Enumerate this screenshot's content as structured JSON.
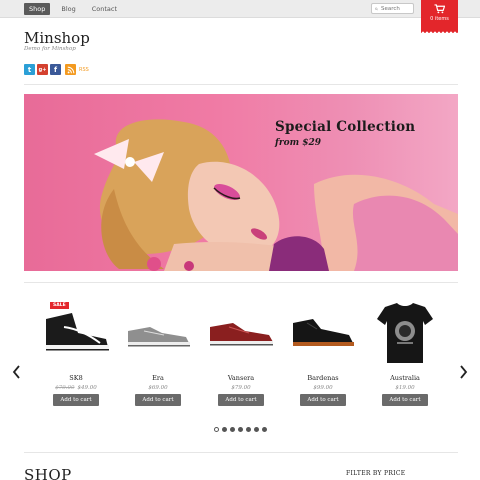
{
  "nav": {
    "items": [
      {
        "label": "Shop",
        "active": true
      },
      {
        "label": "Blog",
        "active": false
      },
      {
        "label": "Contact",
        "active": false
      }
    ]
  },
  "search": {
    "placeholder": "Search"
  },
  "cart": {
    "label": "0 items",
    "icon": "cart-icon",
    "color": "#e3262b"
  },
  "site": {
    "title": "Minshop",
    "tagline": "Demo for Minshop"
  },
  "social": {
    "icons": [
      "twitter-icon",
      "google-plus-icon",
      "facebook-icon",
      "rss-icon"
    ],
    "rss_label": "RSS"
  },
  "banner": {
    "title": "Special Collection",
    "subtitle": "from $29"
  },
  "products": [
    {
      "name": "SK8",
      "old_price": "$79.00",
      "price": "$49.00",
      "button": "Add to cart",
      "badge": "SALE"
    },
    {
      "name": "Era",
      "old_price": "",
      "price": "$69.00",
      "button": "Add to cart",
      "badge": ""
    },
    {
      "name": "Vansera",
      "old_price": "",
      "price": "$79.00",
      "button": "Add to cart",
      "badge": ""
    },
    {
      "name": "Bardenas",
      "old_price": "",
      "price": "$99.00",
      "button": "Add to cart",
      "badge": ""
    },
    {
      "name": "Australia",
      "old_price": "",
      "price": "$19.00",
      "button": "Add to cart",
      "badge": ""
    }
  ],
  "carousel": {
    "page_count": 7,
    "active_page": 1
  },
  "shop_heading": "SHOP",
  "filter_heading": "FILTER BY PRICE"
}
